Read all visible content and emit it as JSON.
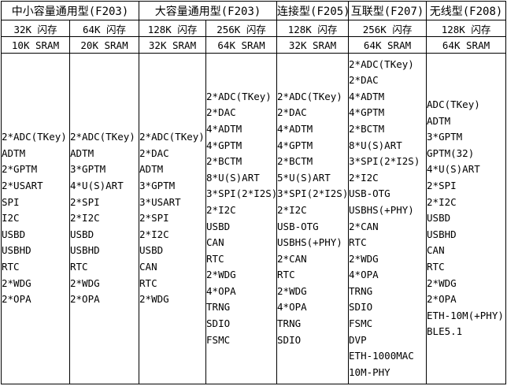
{
  "headers": [
    {
      "title": "中小容量通用型(F203)",
      "variants": [
        {
          "flash": "32K 闪存",
          "sram": "10K SRAM"
        },
        {
          "flash": "64K 闪存",
          "sram": "20K SRAM"
        }
      ]
    },
    {
      "title": "大容量通用型(F203)",
      "variants": [
        {
          "flash": "128K 闪存",
          "sram": "32K SRAM"
        },
        {
          "flash": "256K 闪存",
          "sram": "64K SRAM"
        }
      ]
    },
    {
      "title": "连接型(F205)",
      "variants": [
        {
          "flash": "128K 闪存",
          "sram": "32K SRAM"
        }
      ]
    },
    {
      "title": "互联型(F207)",
      "variants": [
        {
          "flash": "256K 闪存",
          "sram": "64K SRAM"
        }
      ]
    },
    {
      "title": "无线型(F208)",
      "variants": [
        {
          "flash": "128K 闪存",
          "sram": "64K SRAM"
        }
      ]
    }
  ],
  "features": [
    [
      "2*ADC(TKey)",
      "ADTM",
      "2*GPTM",
      "2*USART",
      "SPI",
      "I2C",
      "USBD",
      "USBHD",
      "RTC",
      "2*WDG",
      "2*OPA"
    ],
    [
      "2*ADC(TKey)",
      "ADTM",
      "3*GPTM",
      "4*U(S)ART",
      "2*SPI",
      "2*I2C",
      "USBD",
      "USBHD",
      "RTC",
      "2*WDG",
      "2*OPA"
    ],
    [
      "2*ADC(TKey)",
      "2*DAC",
      "ADTM",
      "3*GPTM",
      "3*USART",
      "2*SPI",
      "2*I2C",
      "USBD",
      "CAN",
      "RTC",
      "2*WDG"
    ],
    [
      "2*ADC(TKey)",
      "2*DAC",
      "4*ADTM",
      "4*GPTM",
      "2*BCTM",
      "8*U(S)ART",
      "3*SPI(2*I2S)",
      "2*I2C",
      "USBD",
      "CAN",
      "RTC",
      "2*WDG",
      "4*OPA",
      "TRNG",
      "SDIO",
      "FSMC"
    ],
    [
      "2*ADC(TKey)",
      "2*DAC",
      "4*ADTM",
      "4*GPTM",
      "2*BCTM",
      "5*U(S)ART",
      "3*SPI(2*I2S)",
      "2*I2C",
      "USB-OTG",
      "USBHS(+PHY)",
      "2*CAN",
      "RTC",
      "2*WDG",
      "4*OPA",
      "TRNG",
      "SDIO"
    ],
    [
      "2*ADC(TKey)",
      "2*DAC",
      "4*ADTM",
      "4*GPTM",
      "2*BCTM",
      "8*U(S)ART",
      "3*SPI(2*I2S)",
      "2*I2C",
      "USB-OTG",
      "USBHS(+PHY)",
      "2*CAN",
      "RTC",
      "2*WDG",
      "4*OPA",
      "TRNG",
      "SDIO",
      "FSMC",
      "DVP",
      "ETH-1000MAC",
      "10M-PHY"
    ],
    [
      "ADC(TKey)",
      "ADTM",
      "3*GPTM",
      "GPTM(32)",
      "4*U(S)ART",
      "2*SPI",
      "2*I2C",
      "USBD",
      "USBHD",
      "CAN",
      "RTC",
      "2*WDG",
      "2*OPA",
      "ETH-10M(+PHY)",
      "BLE5.1"
    ]
  ]
}
